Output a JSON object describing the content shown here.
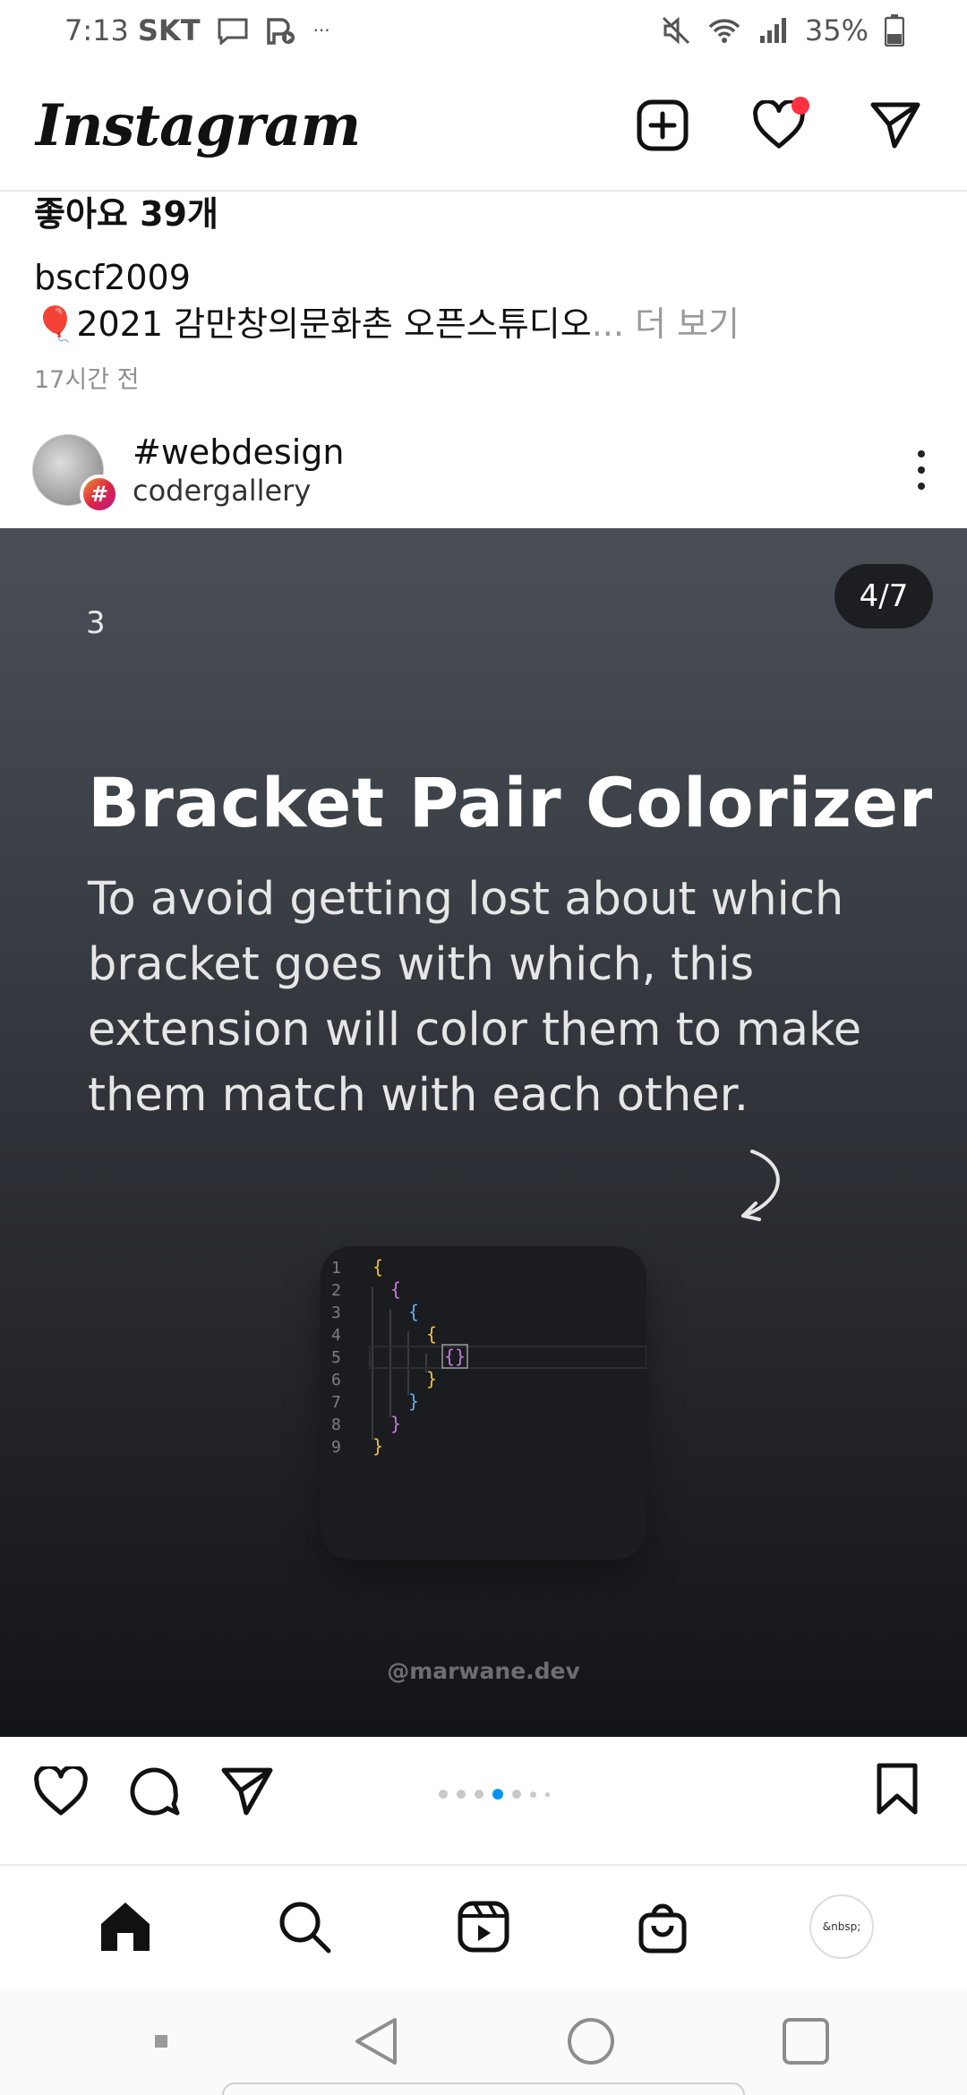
{
  "status_bar": {
    "time": "7:13",
    "carrier": "SKT",
    "overflow": "···",
    "battery": "35%",
    "icons": [
      "message-icon",
      "media-play-icon",
      "mute-icon",
      "wifi-icon",
      "signal-icon",
      "battery-icon"
    ]
  },
  "header": {
    "logo": "Instagram",
    "icons": [
      "new-post-icon",
      "heart-icon",
      "direct-message-icon"
    ]
  },
  "prev_post": {
    "likes": "좋아요 39개",
    "username": "bscf2009",
    "emoji": "🎈",
    "caption": "2021 감만창의문화촌 오픈스튜디오",
    "more": "... 더 보기",
    "time": "17시간 전"
  },
  "post": {
    "hashtag": "#webdesign",
    "account": "codergallery",
    "avatar_badge": "#",
    "counter": "4/7",
    "slide_number": "3",
    "slide_title": "Bracket Pair Colorizer",
    "slide_body": "To avoid getting lost about which bracket goes with which, this extension will color them to make them match with each other.",
    "code_lines": [
      "1",
      "2",
      "3",
      "4",
      "5",
      "6",
      "7",
      "8",
      "9"
    ],
    "watermark": "@marwane.dev",
    "bracket_colors": [
      "#e8c341",
      "#c678dd",
      "#61afef"
    ]
  },
  "carousel": {
    "total": 7,
    "active_index": 3
  },
  "bottom_nav": {
    "items": [
      "home-icon",
      "search-icon",
      "reels-icon",
      "shop-icon",
      "profile-avatar"
    ],
    "profile_text": "&nbsp;"
  }
}
